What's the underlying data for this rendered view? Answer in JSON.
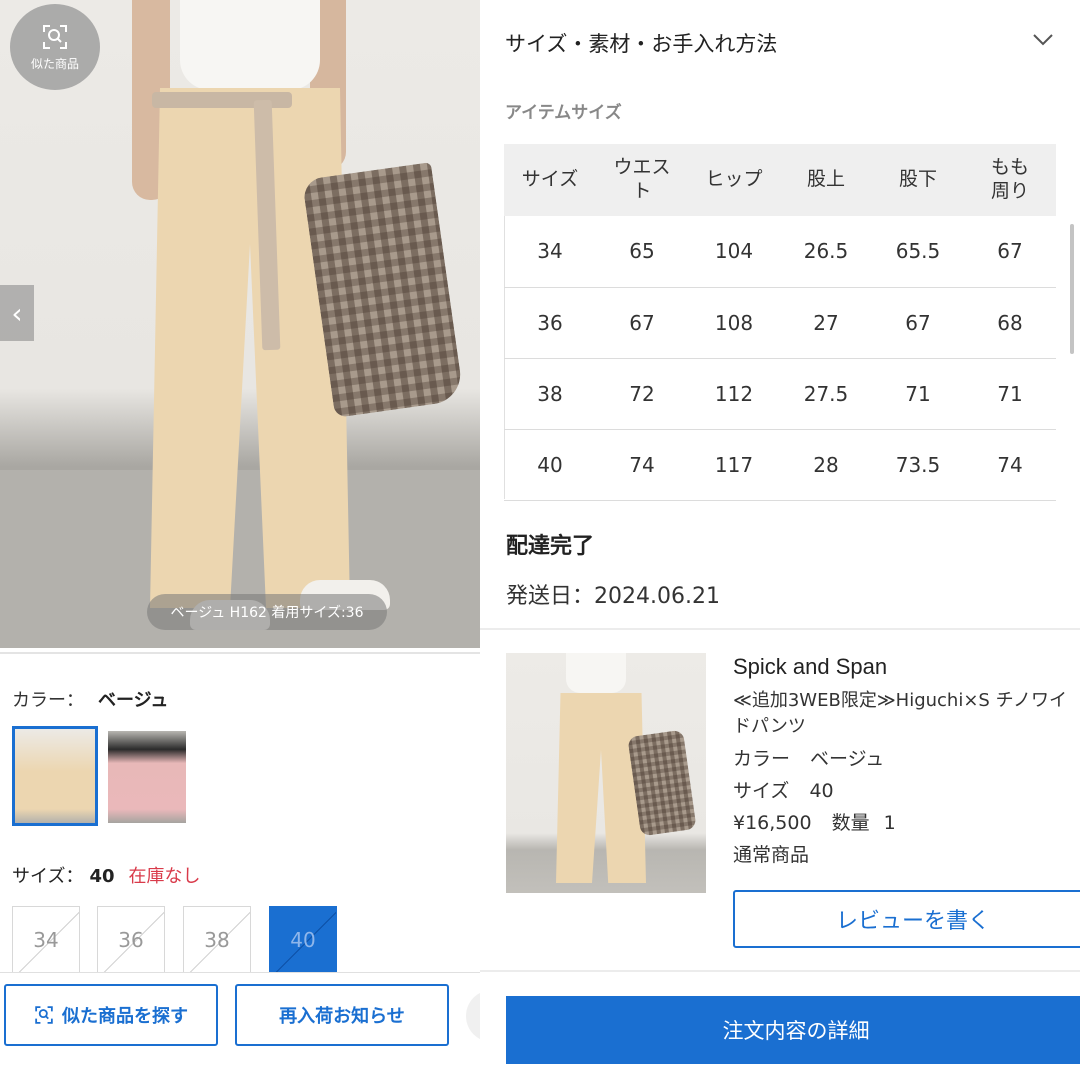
{
  "left": {
    "similar_badge": "似た商品",
    "photo_caption": "ベージュ H162 着用サイズ:36",
    "prev_arrow": "‹",
    "color_label": "カラー：",
    "color_value": "ベージュ",
    "size_label": "サイズ：",
    "size_value": "40",
    "stock_status": "在庫なし",
    "sizes": [
      "34",
      "36",
      "38",
      "40"
    ],
    "selected_size": "40",
    "find_similar_button": "似た商品を探す",
    "restock_notify_button": "再入荷お知らせ"
  },
  "right": {
    "accordion_title": "サイズ・素材・お手入れ方法",
    "item_size_heading": "アイテムサイズ",
    "table": {
      "headers": [
        "サイズ",
        "ウエスト",
        "ヒップ",
        "股上",
        "股下",
        "もも周り"
      ],
      "rows": [
        [
          "34",
          "65",
          "104",
          "26.5",
          "65.5",
          "67"
        ],
        [
          "36",
          "67",
          "108",
          "27",
          "67",
          "68"
        ],
        [
          "38",
          "72",
          "112",
          "27.5",
          "71",
          "71"
        ],
        [
          "40",
          "74",
          "117",
          "28",
          "73.5",
          "74"
        ]
      ]
    },
    "delivery_status": "配達完了",
    "ship_date": "発送日：2024.06.21",
    "order_item": {
      "brand": "Spick and Span",
      "name": "≪追加3WEB限定≫Higuchi×S チノワイドパンツ",
      "color_label": "カラー",
      "color_value": "ベージュ",
      "size_label": "サイズ",
      "size_value": "40",
      "price": "¥16,500",
      "qty_label": "数量",
      "qty_value": "1",
      "type": "通常商品"
    },
    "review_button": "レビューを書く",
    "order_detail_button": "注文内容の詳細"
  },
  "colors": {
    "accent": "#1a6fd1",
    "out_of_stock": "#d93a4a"
  }
}
